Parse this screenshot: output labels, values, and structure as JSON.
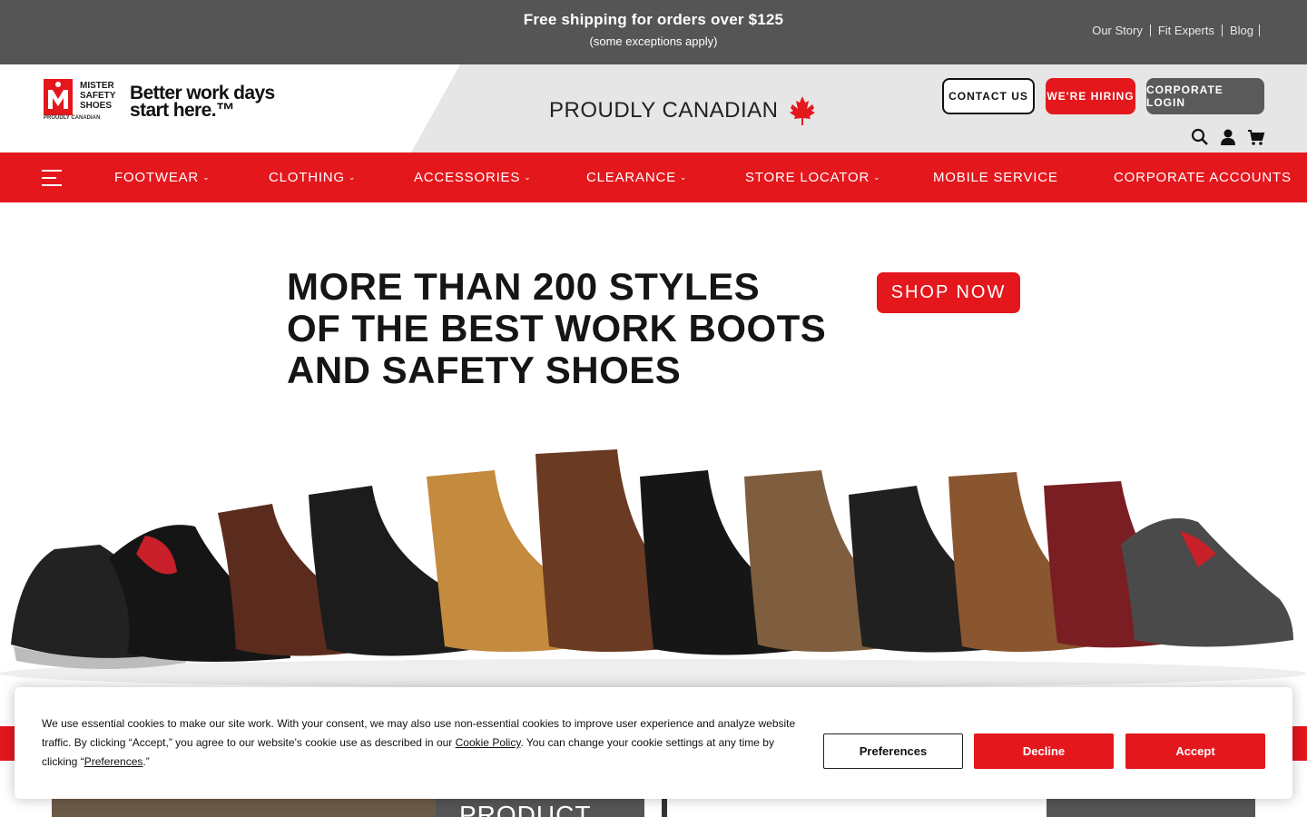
{
  "topbar": {
    "promo_main": "Free shipping for orders over $125",
    "promo_sub": "(some exceptions apply)",
    "links": [
      "Our Story",
      "Fit Experts",
      "Blog"
    ]
  },
  "header": {
    "logo_brand_lines": [
      "MISTER",
      "SAFETY",
      "SHOES"
    ],
    "logo_small_tag": "PROUDLY CANADIAN",
    "logo_tagline_1": "Better work days",
    "logo_tagline_2": "start here.™",
    "proudly": "PROUDLY CANADIAN",
    "buttons": {
      "contact": "CONTACT US",
      "hiring": "WE'RE HIRING",
      "corporate": "CORPORATE LOGIN"
    },
    "icons": [
      "search-icon",
      "account-icon",
      "cart-icon"
    ]
  },
  "nav": {
    "items": [
      {
        "label": "FOOTWEAR",
        "dropdown": true
      },
      {
        "label": "CLOTHING",
        "dropdown": true
      },
      {
        "label": "ACCESSORIES",
        "dropdown": true
      },
      {
        "label": "CLEARANCE",
        "dropdown": true
      },
      {
        "label": "STORE LOCATOR",
        "dropdown": true
      },
      {
        "label": "MOBILE SERVICE",
        "dropdown": false
      },
      {
        "label": "CORPORATE ACCOUNTS",
        "dropdown": false
      }
    ]
  },
  "hero": {
    "title_lines": [
      "MORE THAN 200 STYLES",
      "OF THE BEST WORK BOOTS",
      "AND SAFETY SHOES"
    ],
    "cta": "SHOP NOW"
  },
  "below": {
    "product_label": "PRODUCT"
  },
  "cookie": {
    "text_1": "We use essential cookies to make our site work. With your consent, we may also use non-essential cookies to improve user experience and analyze website traffic. By clicking “Accept,” you agree to our website's cookie use as described in our ",
    "link_policy": "Cookie Policy",
    "text_2": ". You can change your cookie settings at any time by clicking “",
    "link_prefs": "Preferences",
    "text_3": ".”",
    "btn_preferences": "Preferences",
    "btn_decline": "Decline",
    "btn_accept": "Accept"
  },
  "colors": {
    "brand_red": "#e4171d",
    "topbar_grey": "#555555",
    "header_grey": "#e6e6e6"
  }
}
